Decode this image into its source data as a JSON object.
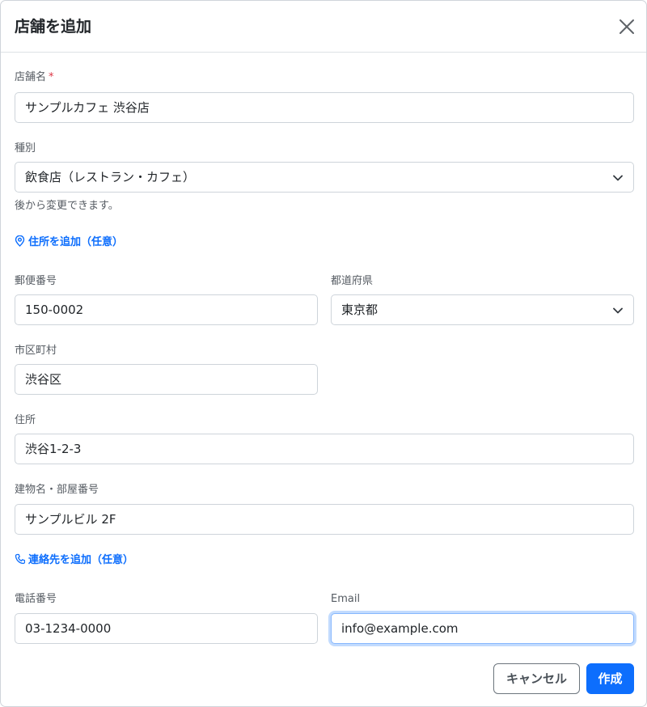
{
  "modal": {
    "title": "店舗を追加"
  },
  "form": {
    "store_name": {
      "label": "店舗名",
      "required_mark": "*",
      "value": "サンプルカフェ 渋谷店"
    },
    "category": {
      "label": "種別",
      "value": "飲食店（レストラン・カフェ）",
      "help": "後から変更できます。"
    },
    "address_section": {
      "link_label": "住所を追加（任意）",
      "icon": "map-pin-icon"
    },
    "postal_code": {
      "label": "郵便番号",
      "value": "150-0002"
    },
    "prefecture": {
      "label": "都道府県",
      "value": "東京都"
    },
    "city": {
      "label": "市区町村",
      "value": "渋谷区"
    },
    "street": {
      "label": "住所",
      "value": "渋谷1-2-3"
    },
    "building": {
      "label": "建物名・部屋番号",
      "value": "サンプルビル 2F"
    },
    "contact_section": {
      "link_label": "連絡先を追加（任意）",
      "icon": "phone-icon"
    },
    "phone": {
      "label": "電話番号",
      "value": "03-1234-0000"
    },
    "email": {
      "label": "Email",
      "value": "info@example.com"
    }
  },
  "footer": {
    "cancel_label": "キャンセル",
    "create_label": "作成"
  },
  "colors": {
    "primary": "#0d6efd",
    "required": "#dc3545",
    "border": "#ced4da",
    "focus_border": "#86b7fe"
  }
}
